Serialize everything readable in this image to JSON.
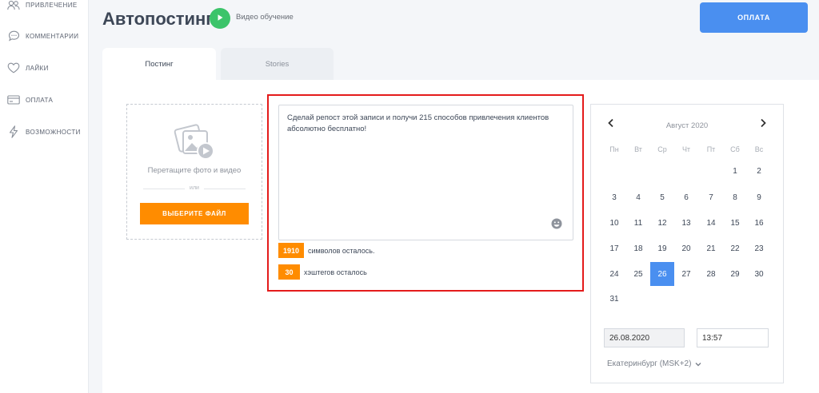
{
  "sidebar": {
    "items": [
      {
        "label": "ПРИВЛЕЧЕНИЕ",
        "icon": "users-icon"
      },
      {
        "label": "КОММЕНТАРИИ",
        "icon": "comment-icon"
      },
      {
        "label": "ЛАЙКИ",
        "icon": "heart-icon"
      },
      {
        "label": "ОПЛАТА",
        "icon": "card-icon"
      },
      {
        "label": "ВОЗМОЖНОСТИ",
        "icon": "lightning-icon"
      }
    ]
  },
  "header": {
    "title": "Автопостинг",
    "video_label": "Видео обучение",
    "pay_label": "ОПЛАТА"
  },
  "tabs": [
    {
      "label": "Постинг",
      "active": true
    },
    {
      "label": "Stories",
      "active": false
    }
  ],
  "upload": {
    "drop_text": "Перетащите фото и видео",
    "or_text": "или",
    "choose_label": "ВЫБЕРИТЕ ФАЙЛ"
  },
  "composer": {
    "text": "Сделай репост этой записи и получи 215 способов привлечения клиентов абсолютно бесплатно!",
    "chars_left": "1910",
    "chars_label": "символов осталось.",
    "hashtags_left": "30",
    "hashtags_label": "хэштегов осталось"
  },
  "calendar": {
    "month": "Август 2020",
    "weekdays": [
      "Пн",
      "Вт",
      "Ср",
      "Чт",
      "Пт",
      "Сб",
      "Вс"
    ],
    "first_weekday_index": 5,
    "days_in_month": 31,
    "selected_day": 26,
    "date_value": "26.08.2020",
    "time_value": "13:57",
    "timezone": "Екатеринбург (MSK+2)"
  },
  "colors": {
    "accent_blue": "#4a8ff0",
    "accent_orange": "#ff8c00",
    "video_green": "#3cc46a",
    "highlight_red": "#e41b1b"
  }
}
